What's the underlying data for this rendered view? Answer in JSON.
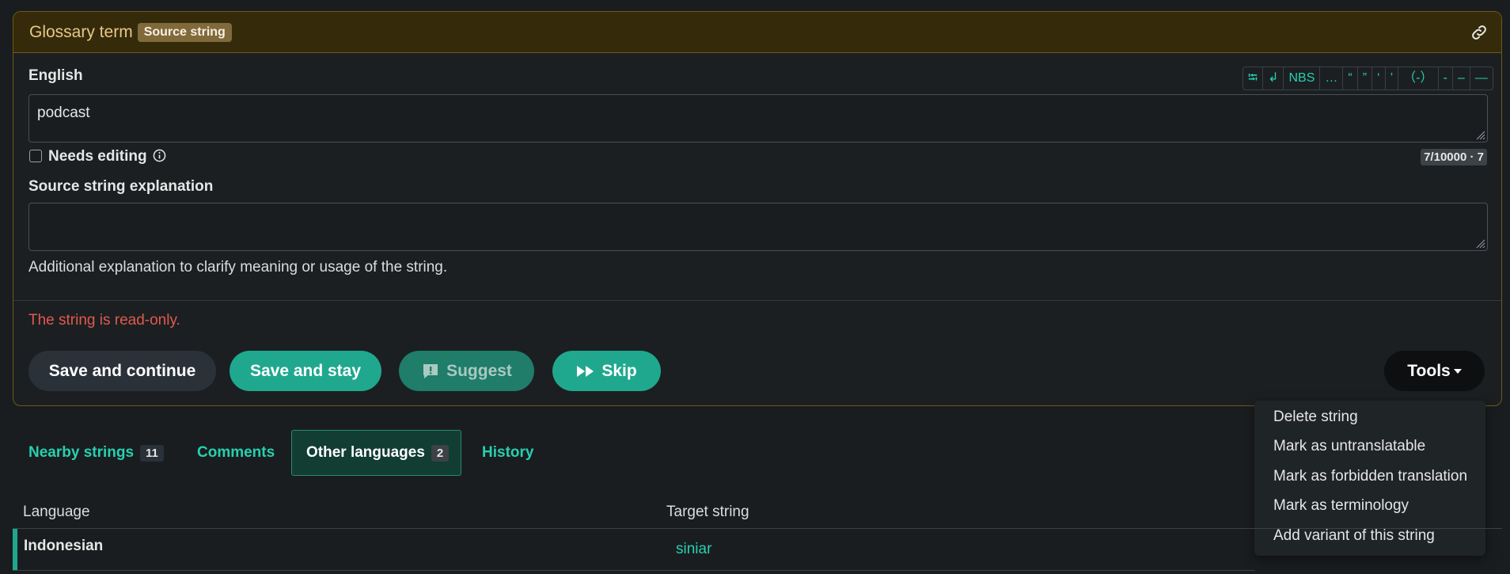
{
  "panel": {
    "title": "Glossary term",
    "badge": "Source string",
    "link_icon": "link-icon"
  },
  "source": {
    "language_label": "English",
    "text": "podcast",
    "needs_editing_label": "Needs editing",
    "counter": "7/10000 · 7"
  },
  "special_chars": [
    "⭾",
    "↲",
    "NBS",
    "…",
    "“",
    "”",
    "‘",
    "’",
    "（-）",
    "-",
    "–",
    "—"
  ],
  "explanation": {
    "label": "Source string explanation",
    "value": "",
    "help": "Additional explanation to clarify meaning or usage of the string."
  },
  "readonly_message": "The string is read-only.",
  "buttons": {
    "save_continue": "Save and continue",
    "save_stay": "Save and stay",
    "suggest": "Suggest",
    "skip": "Skip",
    "tools": "Tools"
  },
  "tools_menu": [
    "Delete string",
    "Mark as untranslatable",
    "Mark as forbidden translation",
    "Mark as terminology",
    "Add variant of this string"
  ],
  "tabs": [
    {
      "label": "Nearby strings",
      "count": "11"
    },
    {
      "label": "Comments"
    },
    {
      "label": "Other languages",
      "count": "2",
      "active": true
    },
    {
      "label": "History"
    }
  ],
  "table": {
    "headers": [
      "Language",
      "Target string"
    ],
    "rows": [
      {
        "language": "Indonesian",
        "target": "siniar"
      }
    ]
  },
  "colors": {
    "accent": "#1fa88e",
    "link": "#27d0b0",
    "error": "#e05a4f",
    "panel_border": "#6e5a16"
  }
}
